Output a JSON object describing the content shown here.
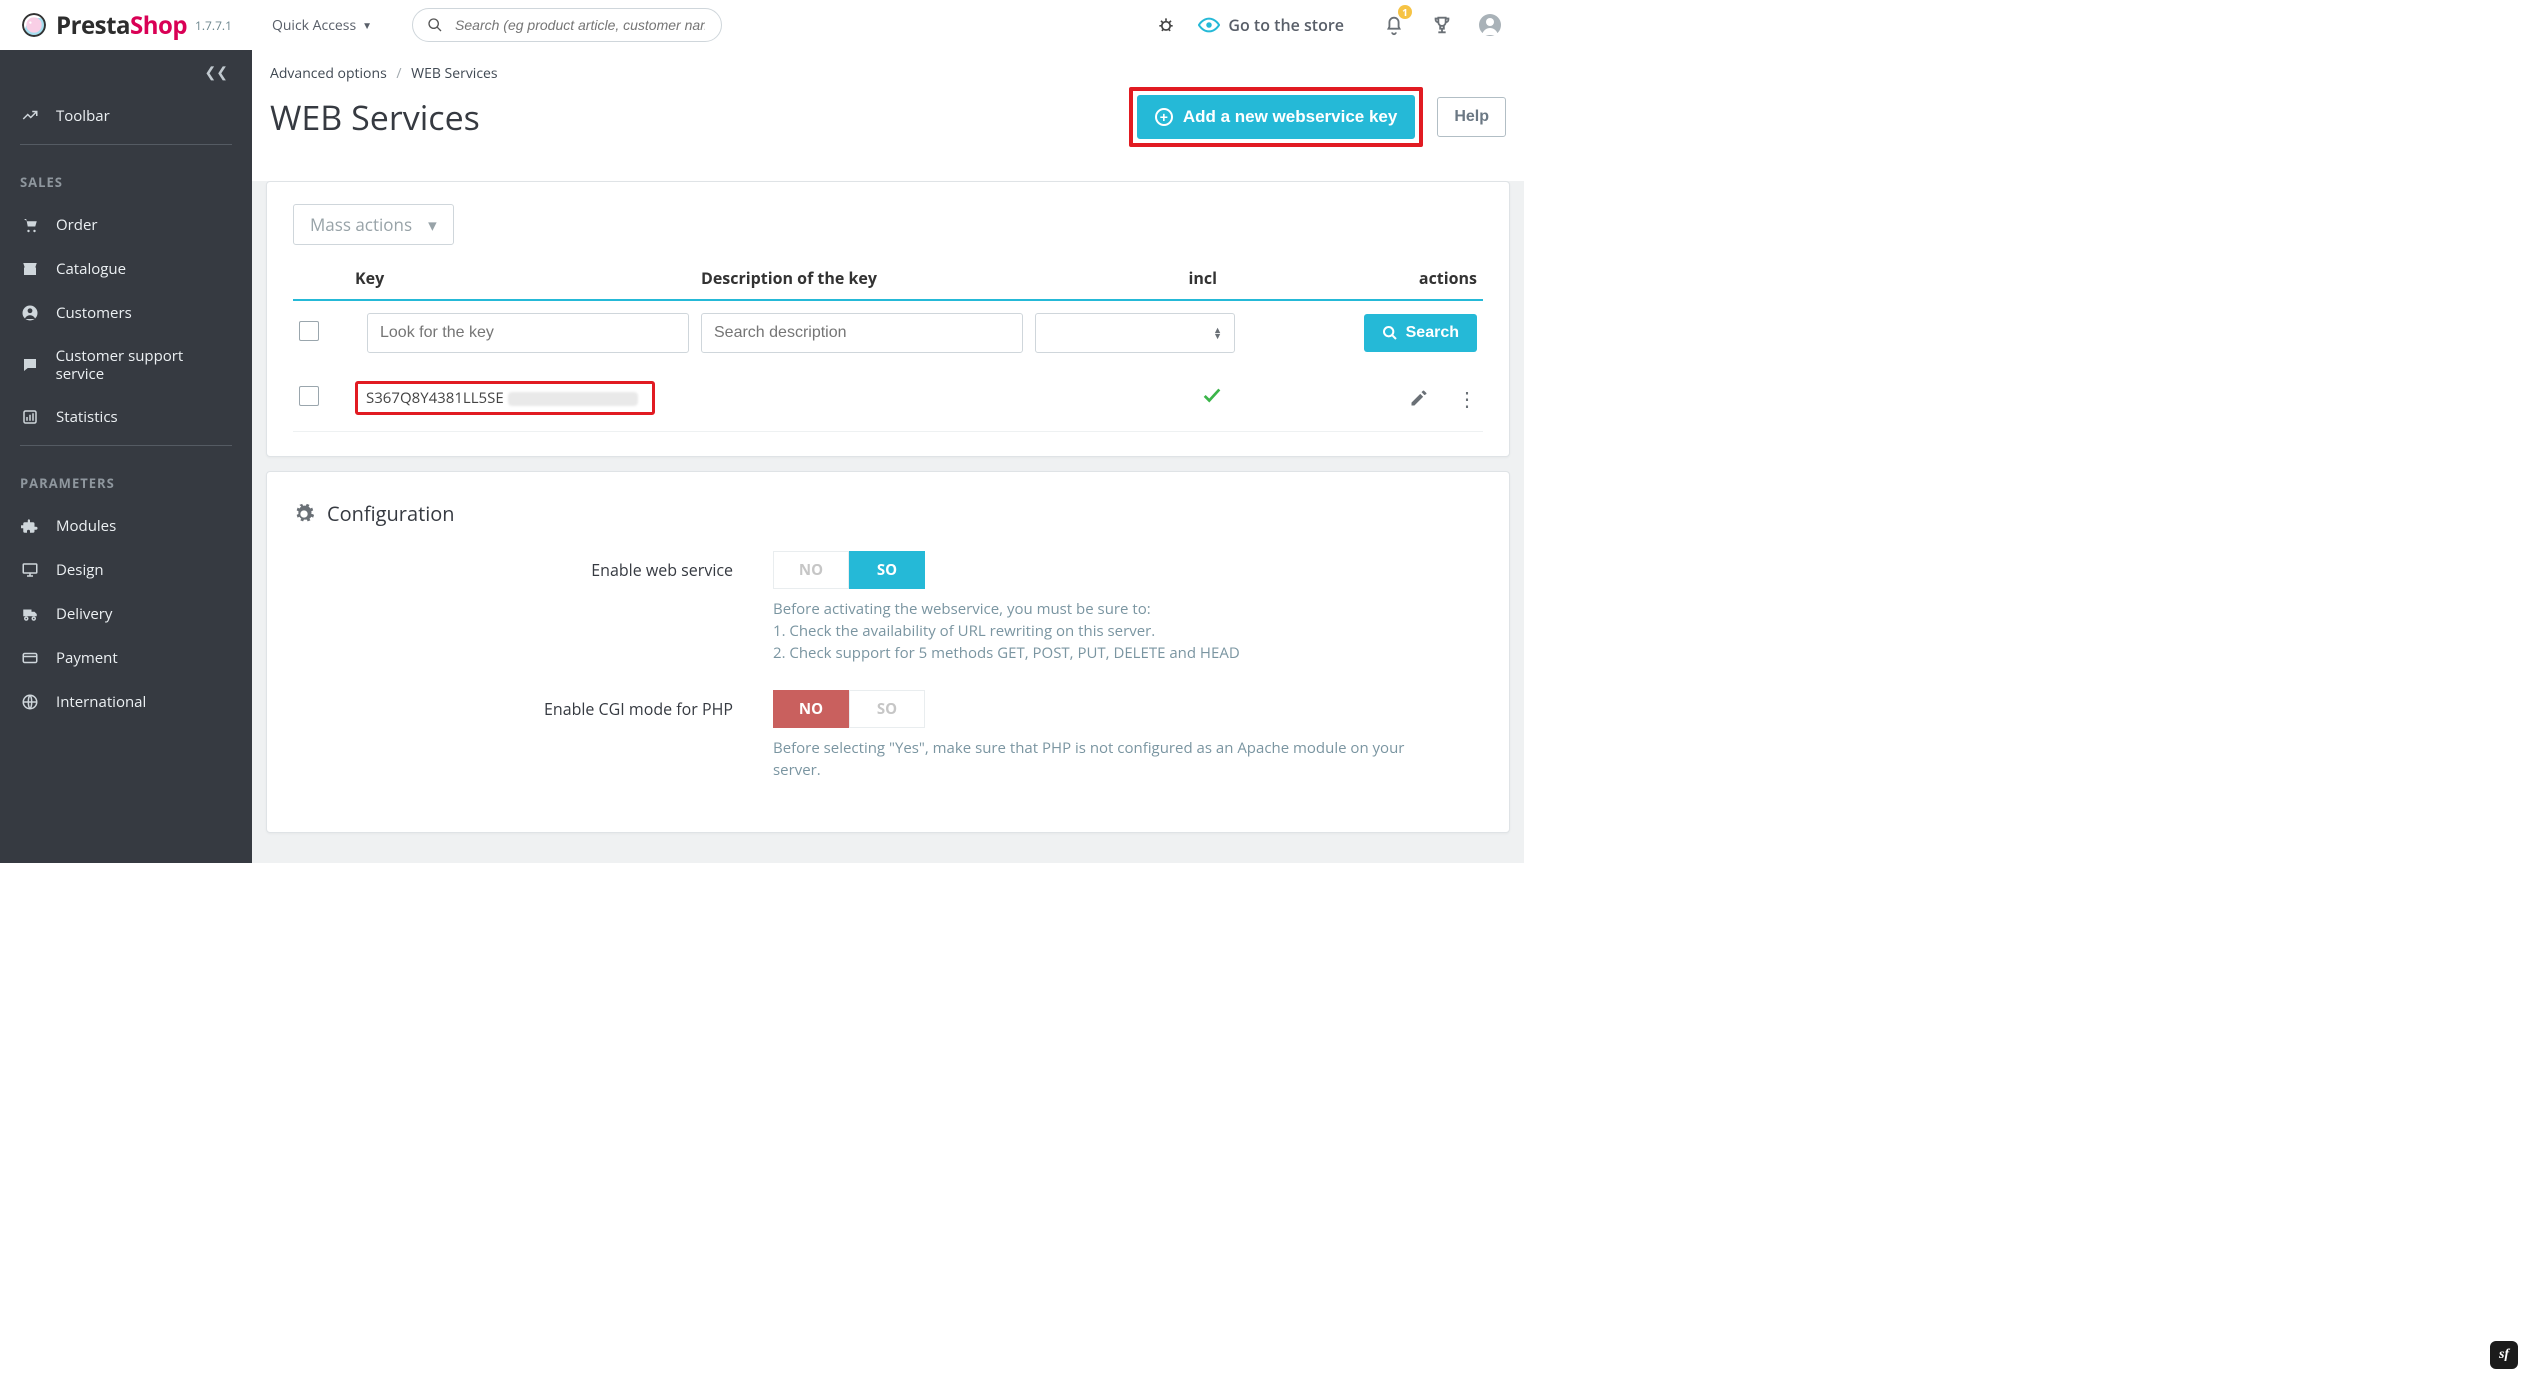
{
  "brand": {
    "presta": "Presta",
    "shop": "Shop",
    "version": "1.7.7.1"
  },
  "topbar": {
    "quick_access": "Quick Access",
    "search_placeholder": "Search (eg product article, customer name)",
    "go_store": "Go to the store",
    "notifications_count": "1"
  },
  "sidebar": {
    "toolbar": "Toolbar",
    "sections": {
      "sales": "SALES",
      "parameters": "PARAMETERS"
    },
    "items": {
      "order": "Order",
      "catalogue": "Catalogue",
      "customers": "Customers",
      "support": "Customer support service",
      "statistics": "Statistics",
      "modules": "Modules",
      "design": "Design",
      "delivery": "Delivery",
      "payment": "Payment",
      "international": "International"
    }
  },
  "breadcrumbs": {
    "a": "Advanced options",
    "b": "WEB Services"
  },
  "heading": "WEB Services",
  "header_buttons": {
    "add_key": "Add a new webservice key",
    "help": "Help"
  },
  "table": {
    "mass_actions": "Mass actions",
    "cols": {
      "key": "Key",
      "desc": "Description of the key",
      "incl": "incl",
      "actions": "actions"
    },
    "filters": {
      "key_ph": "Look for the key",
      "desc_ph": "Search description",
      "search_btn": "Search"
    },
    "rows": [
      {
        "key_visible": "S367Q8Y4381LL5SE",
        "desc": "",
        "incl": true
      }
    ]
  },
  "config": {
    "title": "Configuration",
    "options": {
      "no": "NO",
      "so": "SO"
    },
    "enable_ws": {
      "label": "Enable web service",
      "help_intro": "Before activating the webservice, you must be sure to:",
      "help_1": "1. Check the availability of URL rewriting on this server.",
      "help_2": "2. Check support for 5 methods GET, POST, PUT, DELETE and HEAD"
    },
    "enable_cgi": {
      "label": "Enable CGI mode for PHP",
      "help": "Before selecting \"Yes\", make sure that PHP is not configured as an Apache module on your server."
    }
  }
}
